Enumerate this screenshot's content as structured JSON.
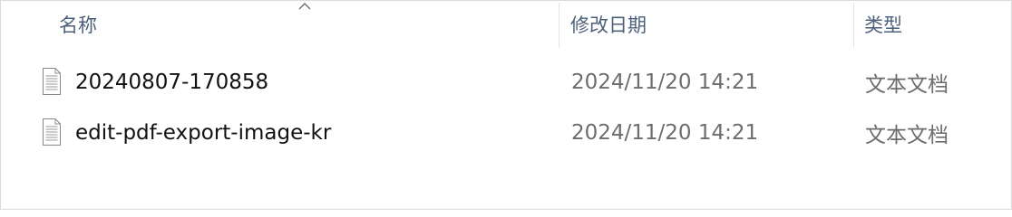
{
  "columns": {
    "name": "名称",
    "modified": "修改日期",
    "type": "类型"
  },
  "sort": {
    "column": "name",
    "direction": "ascending",
    "icon": "chevron-up-icon"
  },
  "files": [
    {
      "icon": "text-file-icon",
      "name": "20240807-170858",
      "modified": "2024/11/20 14:21",
      "type": "文本文档"
    },
    {
      "icon": "text-file-icon",
      "name": "edit-pdf-export-image-kr",
      "modified": "2024/11/20 14:21",
      "type": "文本文档"
    }
  ],
  "colors": {
    "header_text": "#4c607a",
    "name_text": "#111111",
    "meta_text": "#6d6d6d",
    "border": "#dadada"
  }
}
